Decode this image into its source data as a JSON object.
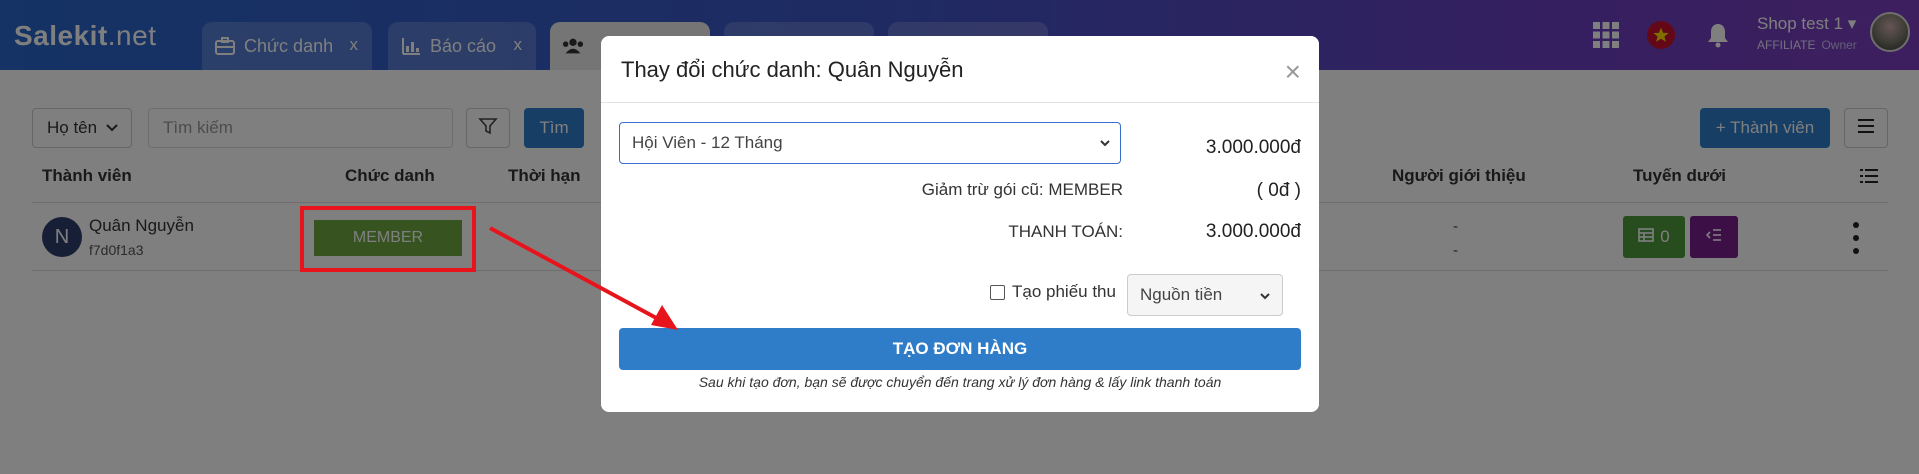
{
  "header": {
    "logo_main": "Salekit",
    "logo_suffix": ".net",
    "tabs": [
      {
        "label": "Chức danh",
        "icon": "briefcase-icon",
        "close": "x"
      },
      {
        "label": "Báo cáo",
        "icon": "bar-chart-icon",
        "close": "x"
      }
    ],
    "user_name": "Shop test 1",
    "user_role": "AFFILIATE",
    "user_owner": "Owner",
    "icons": [
      "apps-grid-icon",
      "vietnam-flag-icon",
      "bell-icon",
      "avatar"
    ]
  },
  "toolbar": {
    "filter_field": "Họ tên",
    "search_placeholder": "Tìm kiếm",
    "search_button": "Tìm",
    "add_button": "+ Thành viên"
  },
  "table": {
    "headers": {
      "member": "Thành viên",
      "title": "Chức danh",
      "duration": "Thời hạn",
      "referrer": "Người giới thiệu",
      "downline": "Tuyến dưới"
    },
    "rows": [
      {
        "avatar_letter": "N",
        "name": "Quân Nguyễn",
        "code": "f7d0f1a3",
        "title_badge": "MEMBER",
        "referrer_line1": "-",
        "referrer_line2": "-",
        "downline_count": "0"
      }
    ]
  },
  "modal": {
    "title": "Thay đổi chức danh: Quân Nguyễn",
    "close": "×",
    "plan_selected": "Hội Viên - 12 Tháng",
    "plan_price": "3.000.000đ",
    "deduct_label": "Giảm trừ gói cũ: MEMBER",
    "deduct_value": "( 0đ )",
    "total_label": "THANH TOÁN:",
    "total_value": "3.000.000đ",
    "receipt_label": "Tạo phiếu thu",
    "receipt_checked": false,
    "source_select": "Nguồn tiền",
    "create_button": "TẠO ĐƠN HÀNG",
    "create_note": "Sau khi tạo đơn, bạn sẽ được chuyển đến trang xử lý đơn hàng & lấy link thanh toán"
  },
  "colors": {
    "primary": "#2f7dc8",
    "member_badge": "#6ca640",
    "highlight": "#e8141b",
    "green_button": "#4e9a3c",
    "purple_button": "#7a1f8f"
  }
}
